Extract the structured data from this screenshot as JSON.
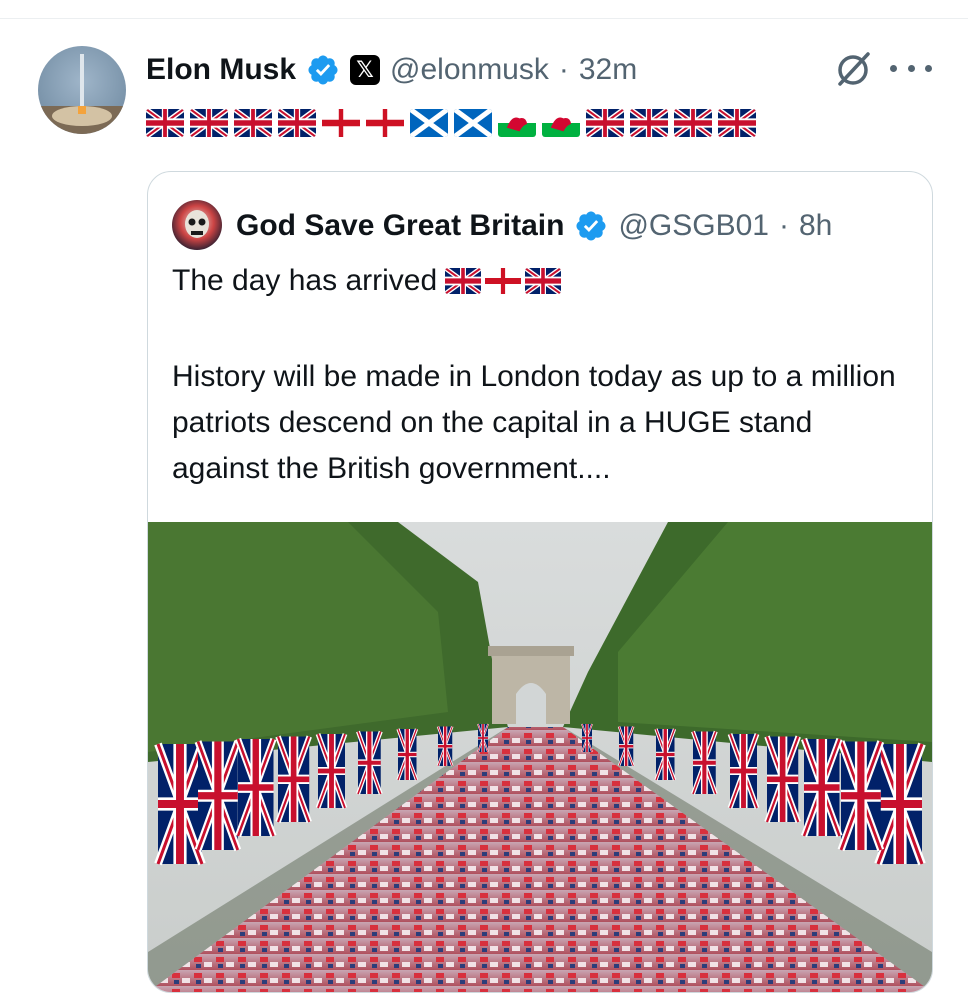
{
  "post": {
    "author_name": "Elon Musk",
    "author_handle": "@elonmusk",
    "separator": "·",
    "time": "32m",
    "flags": [
      "gb",
      "gb",
      "gb",
      "gb",
      "eng",
      "eng",
      "sco",
      "sco",
      "wal",
      "wal",
      "gb",
      "gb",
      "gb",
      "gb"
    ]
  },
  "quote": {
    "author_name": "God Save Great Britain",
    "author_handle": "@GSGB01",
    "separator": "·",
    "time": "8h",
    "line1": "The day has arrived",
    "line1_flags": [
      "gb",
      "eng",
      "gb"
    ],
    "body": "History will be made in London today as up to a million patriots descend on the capital in a HUGE stand against the British government...."
  },
  "icons": {
    "verified": "verified-badge-icon",
    "x_logo": "x-logo-icon",
    "grok": "grok-icon",
    "more": "more-options-icon"
  },
  "colors": {
    "verified_blue": "#1d9bf0",
    "secondary_text": "#536471",
    "border": "#cfd9de"
  }
}
